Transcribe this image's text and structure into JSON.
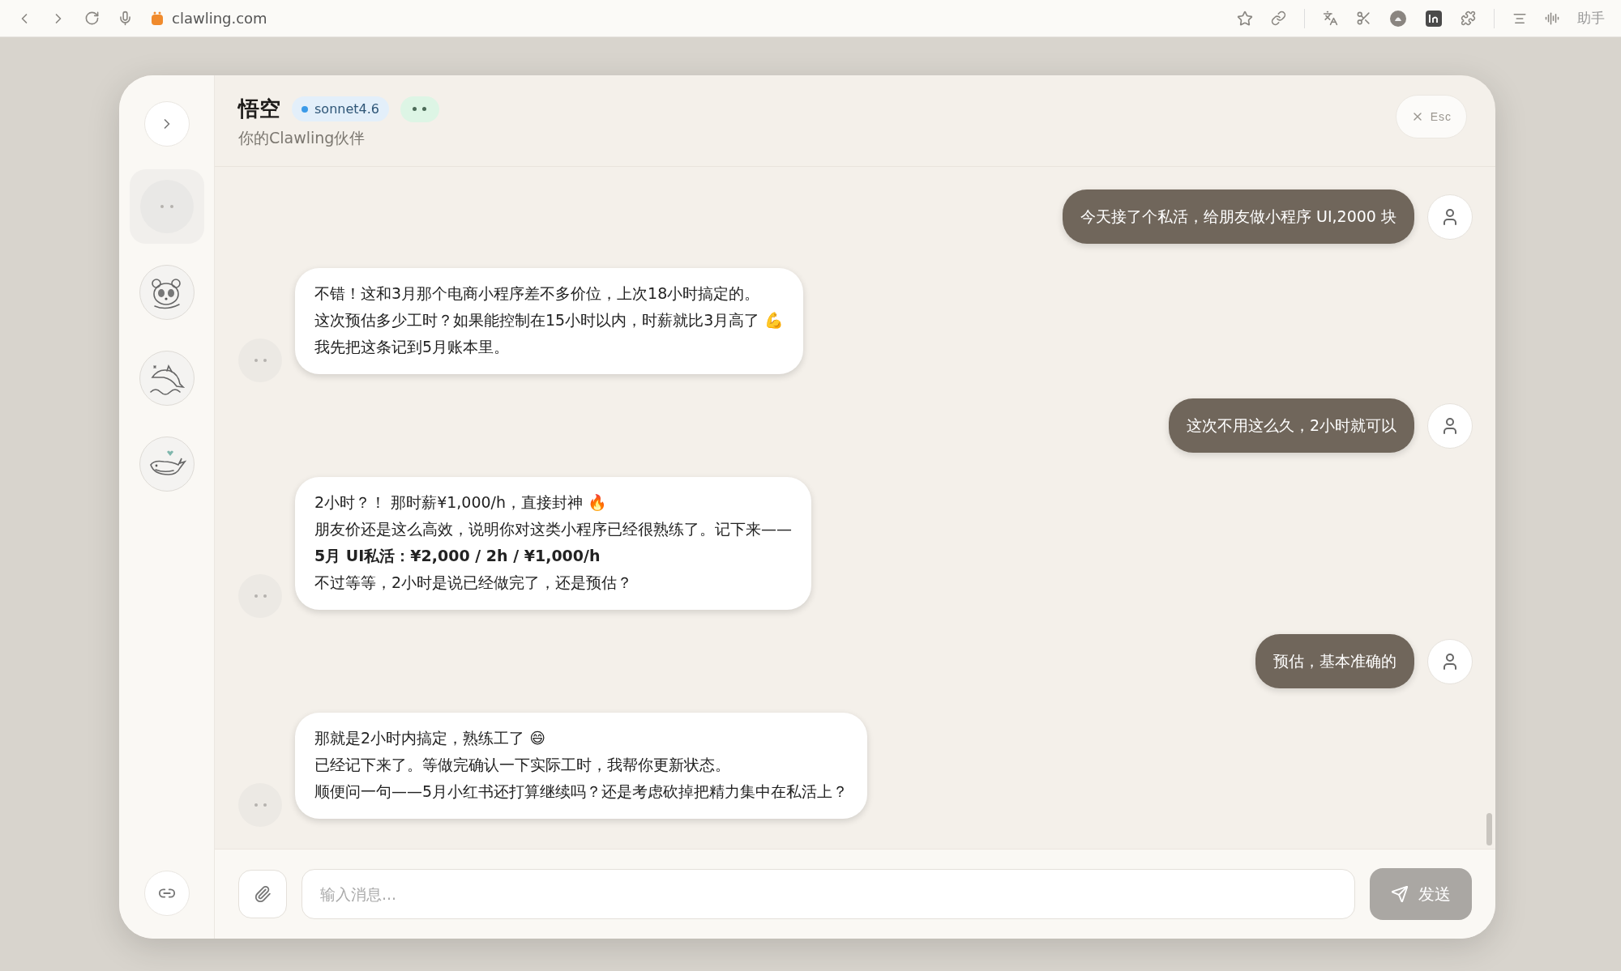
{
  "browser": {
    "url": "clawling.com",
    "assistant_label": "助手"
  },
  "chat": {
    "title": "悟空",
    "model_badge": "sonnet4.6",
    "subtitle": "你的Clawling伙伴",
    "close_label": "Esc"
  },
  "agents": [
    {
      "kind": "placeholder",
      "selected": true
    },
    {
      "kind": "panda",
      "selected": false
    },
    {
      "kind": "dolphin",
      "selected": false
    },
    {
      "kind": "whale",
      "selected": false
    }
  ],
  "messages": [
    {
      "kind": "user",
      "lines": [
        "今天接了个私活，给朋友做小程序 UI,2000 块"
      ]
    },
    {
      "kind": "assistant",
      "lines": [
        "不错！这和3月那个电商小程序差不多价位，上次18小时搞定的。",
        "这次预估多少工时？如果能控制在15小时以内，时薪就比3月高了 💪",
        "我先把这条记到5月账本里。"
      ]
    },
    {
      "kind": "user",
      "lines": [
        "这次不用这么久，2小时就可以"
      ]
    },
    {
      "kind": "assistant",
      "lines": [
        "2小时？！ 那时薪¥1,000/h，直接封神 🔥",
        "朋友价还是这么高效，说明你对这类小程序已经很熟练了。记下来——",
        "**5月 UI私活：¥2,000 / 2h / ¥1,000/h**",
        "不过等等，2小时是说已经做完了，还是预估？"
      ]
    },
    {
      "kind": "user",
      "lines": [
        "预估，基本准确的"
      ]
    },
    {
      "kind": "assistant",
      "lines": [
        "那就是2小时内搞定，熟练工了 😄",
        "已经记下来了。等做完确认一下实际工时，我帮你更新状态。",
        "顺便问一句——5月小红书还打算继续吗？还是考虑砍掉把精力集中在私活上？"
      ]
    }
  ],
  "composer": {
    "placeholder": "输入消息...",
    "send_button": {
      "label": "发送",
      "disabled": true
    }
  }
}
